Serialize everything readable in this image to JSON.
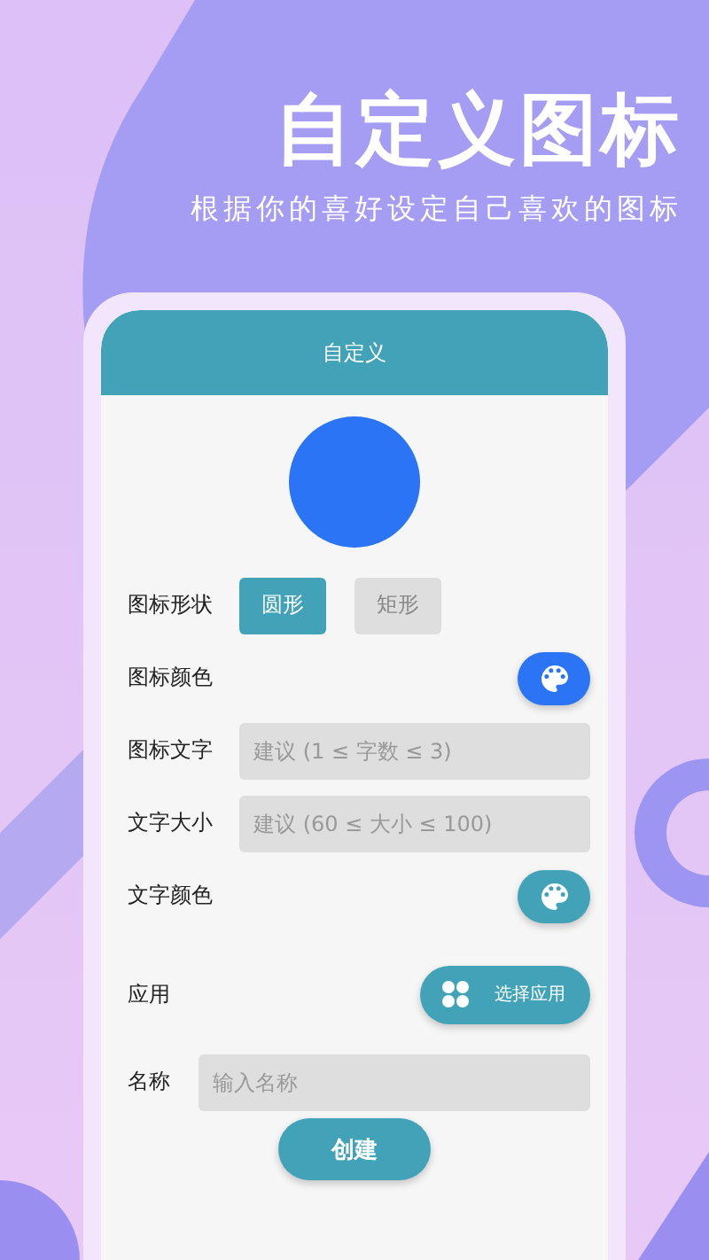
{
  "banner": {
    "title": "自定义图标",
    "subtitle": "根据你的喜好设定自己喜欢的图标"
  },
  "app": {
    "title": "自定义",
    "preview": {
      "color": "#2a74f5"
    },
    "rows": [
      {
        "kind": "shape",
        "label": "图标形状",
        "options": [
          {
            "label": "圆形",
            "selected": true
          },
          {
            "label": "矩形",
            "selected": false
          }
        ]
      },
      {
        "kind": "color",
        "label": "图标颜色",
        "color": "#2a74f5"
      },
      {
        "kind": "input",
        "label": "图标文字",
        "placeholder": "建议 (1 ≤ 字数 ≤ 3)"
      },
      {
        "kind": "input",
        "label": "文字大小",
        "placeholder": "建议 (60 ≤ 大小 ≤ 100)"
      },
      {
        "kind": "color",
        "label": "文字颜色",
        "color": "#42a3b8"
      },
      {
        "kind": "app",
        "label": "应用",
        "button": "选择应用"
      },
      {
        "kind": "input",
        "label": "名称",
        "placeholder": "输入名称"
      }
    ],
    "create_button": "创建"
  }
}
